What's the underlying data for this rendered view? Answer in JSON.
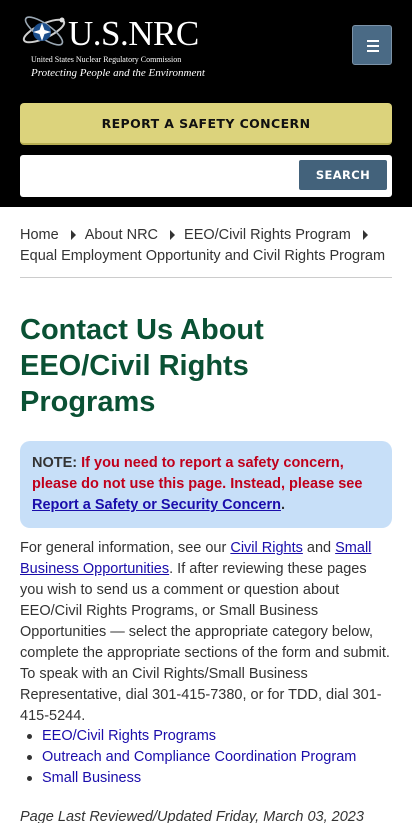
{
  "header": {
    "logo_main": "U.S.NRC",
    "logo_sub": "United States Nuclear Regulatory Commission",
    "logo_tagline": "Protecting People and the Environment",
    "menu_icon": "hamburger-icon",
    "report_button": "REPORT A SAFETY CONCERN",
    "search": {
      "placeholder": "",
      "value": "",
      "button": "SEARCH"
    },
    "colors": {
      "background": "#000000",
      "report": "#dcd37c",
      "search_button": "#43627b"
    }
  },
  "breadcrumb": {
    "items": [
      "Home",
      "About NRC",
      "EEO/Civil Rights Program",
      "Equal Employment Opportunity and Civil Rights Program"
    ]
  },
  "main": {
    "title": "Contact Us About EEO/Civil Rights Programs",
    "note": {
      "label": "NOTE:",
      "text": "If you need to report a safety concern, please do not use this page. Instead, please see",
      "link": "Report a Safety or Security Concern",
      "end": "."
    },
    "paragraph": {
      "before_link1": "For general information, see our",
      "link1": "Civil Rights",
      "between": "and",
      "link2": "Small Business Opportunities",
      "after": ". If after reviewing these pages you wish to send us a comment or question about EEO/Civil Rights Programs, or Small Business Opportunities — select the appropriate category below, complete the appropriate sections of the form and submit. To speak with an Civil Rights/Small Business Representative, dial 301-415-7380, or for TDD, dial 301-415-5244."
    },
    "links": [
      "EEO/Civil Rights Programs",
      "Outreach and Compliance Coordination Program",
      "Small Business"
    ],
    "reviewed": "Page Last Reviewed/Updated Friday, March 03, 2023",
    "colors": {
      "title": "#0a5134",
      "note_bg": "#c7dff8",
      "note_text": "#c0001b",
      "link": "#1a0dab"
    }
  }
}
